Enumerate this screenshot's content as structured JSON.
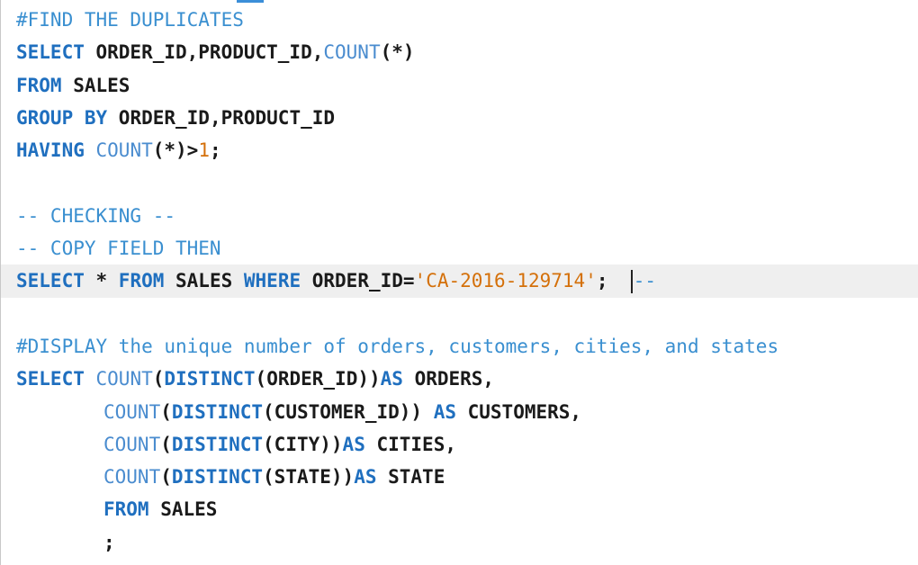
{
  "editor": {
    "lines": [
      {
        "parts": [
          {
            "t": "#FIND THE DUPLICATES",
            "c": "cm"
          }
        ]
      },
      {
        "parts": [
          {
            "t": "SELECT",
            "c": "kw"
          },
          {
            "t": " ORDER_ID,PRODUCT_ID,",
            "c": "id"
          },
          {
            "t": "COUNT",
            "c": "fn"
          },
          {
            "t": "(*)",
            "c": "pn"
          }
        ]
      },
      {
        "parts": [
          {
            "t": "FROM",
            "c": "kw"
          },
          {
            "t": " SALES",
            "c": "id"
          }
        ]
      },
      {
        "parts": [
          {
            "t": "GROUP BY",
            "c": "kw"
          },
          {
            "t": " ORDER_ID,PRODUCT_ID",
            "c": "id"
          }
        ]
      },
      {
        "parts": [
          {
            "t": "HAVING",
            "c": "kw"
          },
          {
            "t": " ",
            "c": "id"
          },
          {
            "t": "COUNT",
            "c": "fn"
          },
          {
            "t": "(*)>",
            "c": "pn"
          },
          {
            "t": "1",
            "c": "num"
          },
          {
            "t": ";",
            "c": "pn"
          }
        ]
      },
      {
        "parts": []
      },
      {
        "parts": [
          {
            "t": "-- CHECKING --",
            "c": "cm"
          }
        ]
      },
      {
        "parts": [
          {
            "t": "-- COPY FIELD THEN",
            "c": "cm"
          }
        ]
      },
      {
        "parts": [
          {
            "t": "SELECT",
            "c": "kw"
          },
          {
            "t": " * ",
            "c": "id"
          },
          {
            "t": "FROM",
            "c": "kw"
          },
          {
            "t": " SALES ",
            "c": "id"
          },
          {
            "t": "WHERE",
            "c": "kw"
          },
          {
            "t": " ORDER_ID=",
            "c": "id"
          },
          {
            "t": "'CA-2016-129714'",
            "c": "str"
          },
          {
            "t": ";  ",
            "c": "pn"
          },
          {
            "t": "CARET",
            "c": "caret"
          },
          {
            "t": "--",
            "c": "cm"
          }
        ],
        "current": true
      },
      {
        "parts": []
      },
      {
        "parts": [
          {
            "t": "#DISPLAY the unique number of orders, customers, cities, and states",
            "c": "cm"
          }
        ]
      },
      {
        "parts": [
          {
            "t": "SELECT",
            "c": "kw"
          },
          {
            "t": " ",
            "c": "id"
          },
          {
            "t": "COUNT",
            "c": "fn"
          },
          {
            "t": "(",
            "c": "pn"
          },
          {
            "t": "DISTINCT",
            "c": "kw"
          },
          {
            "t": "(ORDER_ID))",
            "c": "pn"
          },
          {
            "t": "AS",
            "c": "kw"
          },
          {
            "t": " ORDERS,",
            "c": "id"
          }
        ]
      },
      {
        "parts": [
          {
            "t": "COUNT",
            "c": "fn"
          },
          {
            "t": "(",
            "c": "pn"
          },
          {
            "t": "DISTINCT",
            "c": "kw"
          },
          {
            "t": "(CUSTOMER_ID)) ",
            "c": "pn"
          },
          {
            "t": "AS",
            "c": "kw"
          },
          {
            "t": " CUSTOMERS,",
            "c": "id"
          }
        ],
        "indent": true
      },
      {
        "parts": [
          {
            "t": "COUNT",
            "c": "fn"
          },
          {
            "t": "(",
            "c": "pn"
          },
          {
            "t": "DISTINCT",
            "c": "kw"
          },
          {
            "t": "(CITY))",
            "c": "pn"
          },
          {
            "t": "AS",
            "c": "kw"
          },
          {
            "t": " CITIES,",
            "c": "id"
          }
        ],
        "indent": true
      },
      {
        "parts": [
          {
            "t": "COUNT",
            "c": "fn"
          },
          {
            "t": "(",
            "c": "pn"
          },
          {
            "t": "DISTINCT",
            "c": "kw"
          },
          {
            "t": "(STATE))",
            "c": "pn"
          },
          {
            "t": "AS",
            "c": "kw"
          },
          {
            "t": " STATE",
            "c": "id"
          }
        ],
        "indent": true
      },
      {
        "parts": [
          {
            "t": "FROM",
            "c": "kw"
          },
          {
            "t": " SALES",
            "c": "id"
          }
        ],
        "indent": true
      },
      {
        "parts": [
          {
            "t": ";",
            "c": "pn"
          }
        ],
        "indent": true
      }
    ]
  },
  "colors": {
    "keyword": "#1f6fbf",
    "function": "#4a8ccf",
    "comment": "#3a8fd0",
    "string": "#d4700a",
    "current_line": "#efefef"
  }
}
